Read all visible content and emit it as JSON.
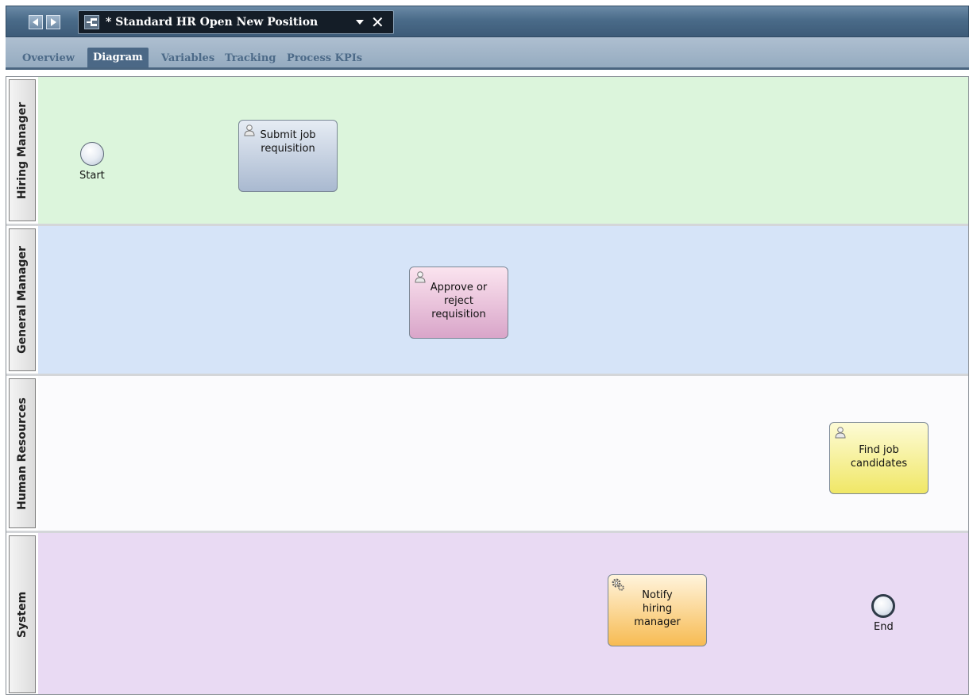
{
  "window": {
    "doc_title": "* Standard HR Open New Position",
    "back_icon": "back-arrow-icon",
    "forward_icon": "forward-arrow-icon",
    "process_icon": "process-app-icon",
    "dropdown_icon": "dropdown-arrow-icon",
    "close_icon": "close-icon",
    "close_glyph": "✕"
  },
  "tabs": [
    {
      "label": "Overview",
      "active": false
    },
    {
      "label": "Diagram",
      "active": true
    },
    {
      "label": "Variables",
      "active": false
    },
    {
      "label": "Tracking",
      "active": false
    },
    {
      "label": "Process KPIs",
      "active": false
    }
  ],
  "diagram": {
    "lanes": [
      {
        "label": "Hiring Manager",
        "color": "#dcf5dc"
      },
      {
        "label": "General Manager",
        "color": "#d6e4f8"
      },
      {
        "label": "Human Resources",
        "color": "#fbfbfd"
      },
      {
        "label": "System",
        "color": "#e9daf3"
      }
    ],
    "events": {
      "start": {
        "label": "Start"
      },
      "end": {
        "label": "End"
      }
    },
    "tasks": {
      "submit": {
        "label_lines": [
          "Submit job",
          "requisition"
        ],
        "type": "user",
        "color_top": "#e6ecf4",
        "color_bottom": "#a9b9d0"
      },
      "approve": {
        "label_lines": [
          "Approve or",
          "reject",
          "requisition"
        ],
        "type": "user",
        "color_top": "#fbe4ef",
        "color_bottom": "#d9a5c9"
      },
      "find": {
        "label_lines": [
          "Find job",
          "candidates"
        ],
        "type": "user",
        "color_top": "#fdfbd6",
        "color_bottom": "#f0e766"
      },
      "notify": {
        "label_lines": [
          "Notify",
          "hiring",
          "manager"
        ],
        "type": "system",
        "color_top": "#fff4dc",
        "color_bottom": "#f7bb52"
      }
    }
  }
}
